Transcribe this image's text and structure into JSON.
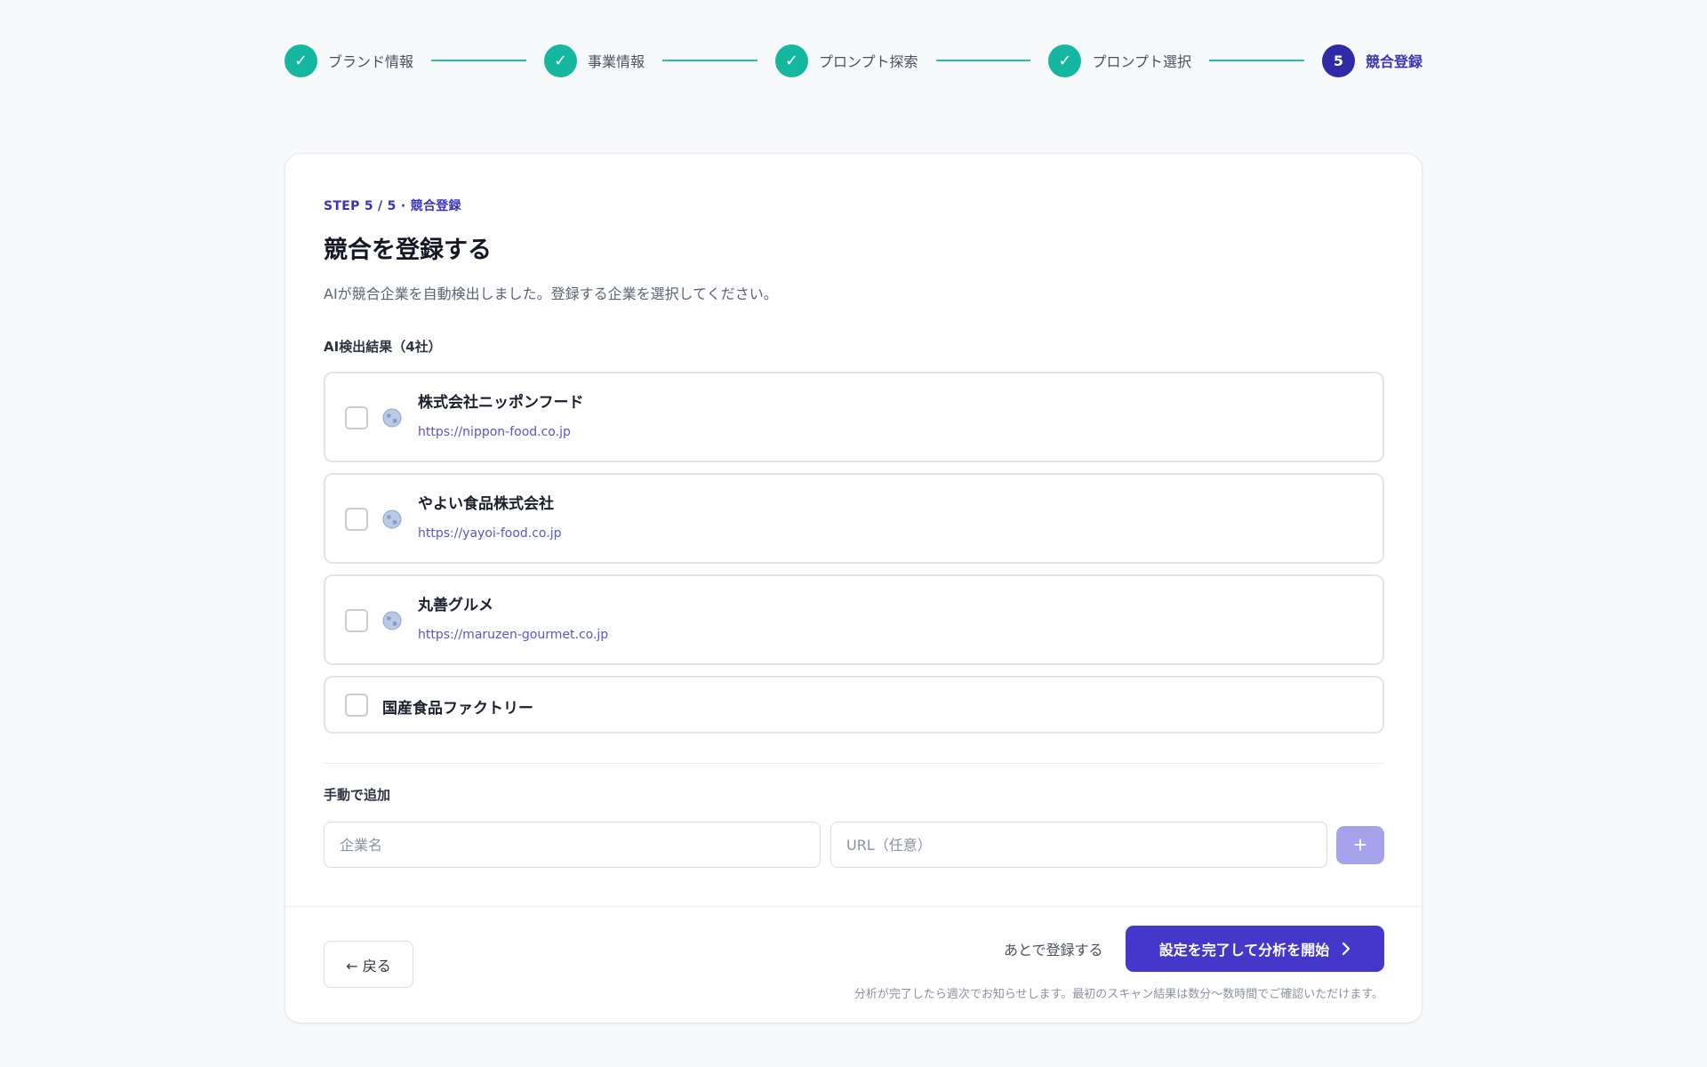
{
  "stepper": {
    "steps": [
      {
        "label": "ブランド情報",
        "state": "done",
        "mark": "✓"
      },
      {
        "label": "事業情報",
        "state": "done",
        "mark": "✓"
      },
      {
        "label": "プロンプト探索",
        "state": "done",
        "mark": "✓"
      },
      {
        "label": "プロンプト選択",
        "state": "done",
        "mark": "✓"
      },
      {
        "label": "競合登録",
        "state": "active",
        "mark": "5"
      }
    ]
  },
  "header": {
    "step_meta": "STEP 5 / 5 · 競合登録",
    "title": "競合を登録する",
    "subtitle": "AIが競合企業を自動検出しました。登録する企業を選択してください。"
  },
  "detected": {
    "label": "AI検出結果（4社）",
    "items": [
      {
        "name": "株式会社ニッポンフード",
        "url": "https://nippon-food.co.jp",
        "checked": false,
        "icon": "globe-icon"
      },
      {
        "name": "やよい食品株式会社",
        "url": "https://yayoi-food.co.jp",
        "checked": false,
        "icon": "globe-icon"
      },
      {
        "name": "丸善グルメ",
        "url": "https://maruzen-gourmet.co.jp",
        "checked": false,
        "icon": "globe-icon"
      },
      {
        "name": "国産食品ファクトリー",
        "checked": false
      }
    ]
  },
  "manual": {
    "label": "手動で追加",
    "company_placeholder": "企業名",
    "url_placeholder": "URL（任意）",
    "add_label": "+"
  },
  "footer": {
    "back_label": "← 戻る",
    "later_label": "あとで登録する",
    "submit_label": "設定を完了して分析を開始",
    "submit_icon": "chevron-right-icon",
    "note": "分析が完了したら週次でお知らせします。最初のスキャン結果は数分〜数時間でご確認いただけます。"
  },
  "colors": {
    "accent": "#4338ca",
    "done": "#16b7a0",
    "active_step": "#2f2aa6",
    "link": "#5a55c9"
  }
}
